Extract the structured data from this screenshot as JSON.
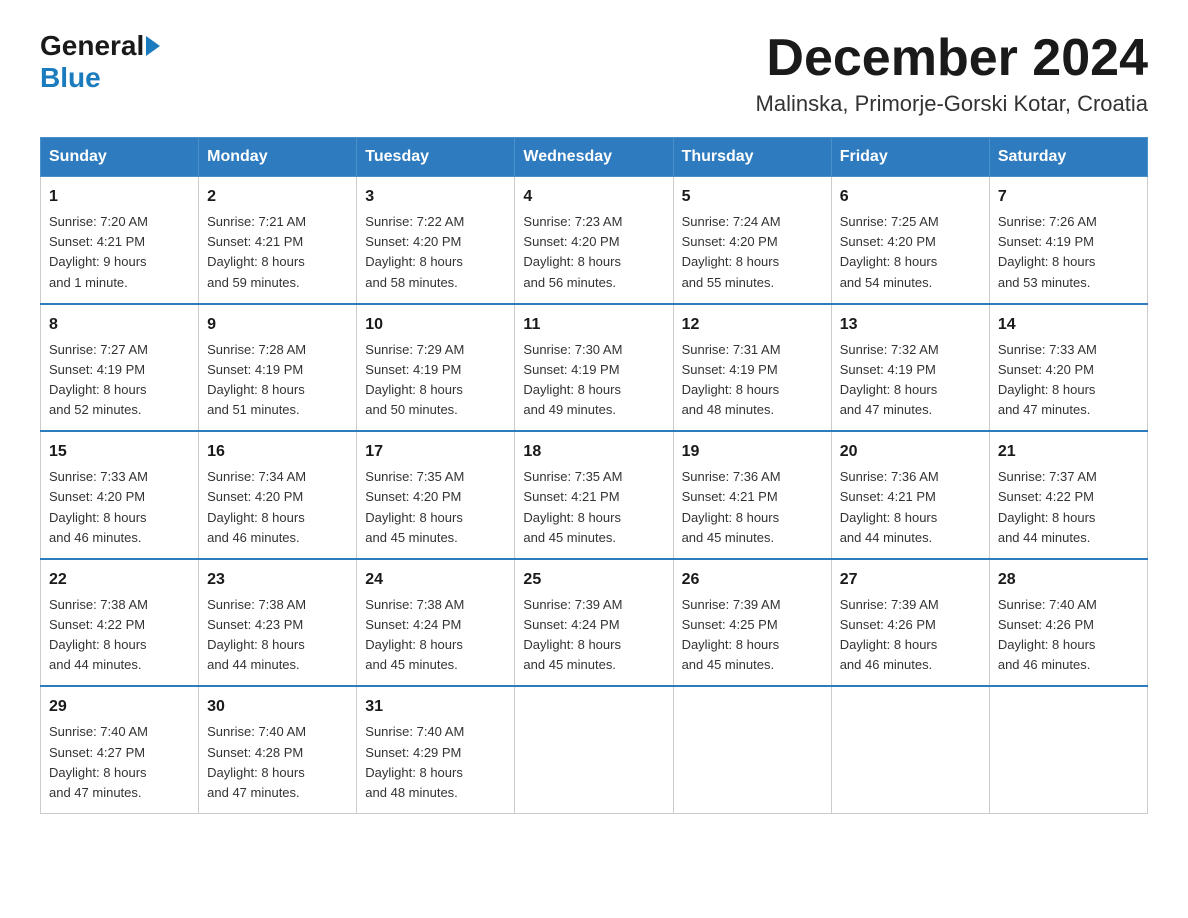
{
  "header": {
    "logo": {
      "general": "General",
      "blue": "Blue"
    },
    "month_year": "December 2024",
    "location": "Malinska, Primorje-Gorski Kotar, Croatia"
  },
  "weekdays": [
    "Sunday",
    "Monday",
    "Tuesday",
    "Wednesday",
    "Thursday",
    "Friday",
    "Saturday"
  ],
  "weeks": [
    [
      {
        "day": "1",
        "sunrise": "Sunrise: 7:20 AM",
        "sunset": "Sunset: 4:21 PM",
        "daylight": "Daylight: 9 hours",
        "daylight2": "and 1 minute."
      },
      {
        "day": "2",
        "sunrise": "Sunrise: 7:21 AM",
        "sunset": "Sunset: 4:21 PM",
        "daylight": "Daylight: 8 hours",
        "daylight2": "and 59 minutes."
      },
      {
        "day": "3",
        "sunrise": "Sunrise: 7:22 AM",
        "sunset": "Sunset: 4:20 PM",
        "daylight": "Daylight: 8 hours",
        "daylight2": "and 58 minutes."
      },
      {
        "day": "4",
        "sunrise": "Sunrise: 7:23 AM",
        "sunset": "Sunset: 4:20 PM",
        "daylight": "Daylight: 8 hours",
        "daylight2": "and 56 minutes."
      },
      {
        "day": "5",
        "sunrise": "Sunrise: 7:24 AM",
        "sunset": "Sunset: 4:20 PM",
        "daylight": "Daylight: 8 hours",
        "daylight2": "and 55 minutes."
      },
      {
        "day": "6",
        "sunrise": "Sunrise: 7:25 AM",
        "sunset": "Sunset: 4:20 PM",
        "daylight": "Daylight: 8 hours",
        "daylight2": "and 54 minutes."
      },
      {
        "day": "7",
        "sunrise": "Sunrise: 7:26 AM",
        "sunset": "Sunset: 4:19 PM",
        "daylight": "Daylight: 8 hours",
        "daylight2": "and 53 minutes."
      }
    ],
    [
      {
        "day": "8",
        "sunrise": "Sunrise: 7:27 AM",
        "sunset": "Sunset: 4:19 PM",
        "daylight": "Daylight: 8 hours",
        "daylight2": "and 52 minutes."
      },
      {
        "day": "9",
        "sunrise": "Sunrise: 7:28 AM",
        "sunset": "Sunset: 4:19 PM",
        "daylight": "Daylight: 8 hours",
        "daylight2": "and 51 minutes."
      },
      {
        "day": "10",
        "sunrise": "Sunrise: 7:29 AM",
        "sunset": "Sunset: 4:19 PM",
        "daylight": "Daylight: 8 hours",
        "daylight2": "and 50 minutes."
      },
      {
        "day": "11",
        "sunrise": "Sunrise: 7:30 AM",
        "sunset": "Sunset: 4:19 PM",
        "daylight": "Daylight: 8 hours",
        "daylight2": "and 49 minutes."
      },
      {
        "day": "12",
        "sunrise": "Sunrise: 7:31 AM",
        "sunset": "Sunset: 4:19 PM",
        "daylight": "Daylight: 8 hours",
        "daylight2": "and 48 minutes."
      },
      {
        "day": "13",
        "sunrise": "Sunrise: 7:32 AM",
        "sunset": "Sunset: 4:19 PM",
        "daylight": "Daylight: 8 hours",
        "daylight2": "and 47 minutes."
      },
      {
        "day": "14",
        "sunrise": "Sunrise: 7:33 AM",
        "sunset": "Sunset: 4:20 PM",
        "daylight": "Daylight: 8 hours",
        "daylight2": "and 47 minutes."
      }
    ],
    [
      {
        "day": "15",
        "sunrise": "Sunrise: 7:33 AM",
        "sunset": "Sunset: 4:20 PM",
        "daylight": "Daylight: 8 hours",
        "daylight2": "and 46 minutes."
      },
      {
        "day": "16",
        "sunrise": "Sunrise: 7:34 AM",
        "sunset": "Sunset: 4:20 PM",
        "daylight": "Daylight: 8 hours",
        "daylight2": "and 46 minutes."
      },
      {
        "day": "17",
        "sunrise": "Sunrise: 7:35 AM",
        "sunset": "Sunset: 4:20 PM",
        "daylight": "Daylight: 8 hours",
        "daylight2": "and 45 minutes."
      },
      {
        "day": "18",
        "sunrise": "Sunrise: 7:35 AM",
        "sunset": "Sunset: 4:21 PM",
        "daylight": "Daylight: 8 hours",
        "daylight2": "and 45 minutes."
      },
      {
        "day": "19",
        "sunrise": "Sunrise: 7:36 AM",
        "sunset": "Sunset: 4:21 PM",
        "daylight": "Daylight: 8 hours",
        "daylight2": "and 45 minutes."
      },
      {
        "day": "20",
        "sunrise": "Sunrise: 7:36 AM",
        "sunset": "Sunset: 4:21 PM",
        "daylight": "Daylight: 8 hours",
        "daylight2": "and 44 minutes."
      },
      {
        "day": "21",
        "sunrise": "Sunrise: 7:37 AM",
        "sunset": "Sunset: 4:22 PM",
        "daylight": "Daylight: 8 hours",
        "daylight2": "and 44 minutes."
      }
    ],
    [
      {
        "day": "22",
        "sunrise": "Sunrise: 7:38 AM",
        "sunset": "Sunset: 4:22 PM",
        "daylight": "Daylight: 8 hours",
        "daylight2": "and 44 minutes."
      },
      {
        "day": "23",
        "sunrise": "Sunrise: 7:38 AM",
        "sunset": "Sunset: 4:23 PM",
        "daylight": "Daylight: 8 hours",
        "daylight2": "and 44 minutes."
      },
      {
        "day": "24",
        "sunrise": "Sunrise: 7:38 AM",
        "sunset": "Sunset: 4:24 PM",
        "daylight": "Daylight: 8 hours",
        "daylight2": "and 45 minutes."
      },
      {
        "day": "25",
        "sunrise": "Sunrise: 7:39 AM",
        "sunset": "Sunset: 4:24 PM",
        "daylight": "Daylight: 8 hours",
        "daylight2": "and 45 minutes."
      },
      {
        "day": "26",
        "sunrise": "Sunrise: 7:39 AM",
        "sunset": "Sunset: 4:25 PM",
        "daylight": "Daylight: 8 hours",
        "daylight2": "and 45 minutes."
      },
      {
        "day": "27",
        "sunrise": "Sunrise: 7:39 AM",
        "sunset": "Sunset: 4:26 PM",
        "daylight": "Daylight: 8 hours",
        "daylight2": "and 46 minutes."
      },
      {
        "day": "28",
        "sunrise": "Sunrise: 7:40 AM",
        "sunset": "Sunset: 4:26 PM",
        "daylight": "Daylight: 8 hours",
        "daylight2": "and 46 minutes."
      }
    ],
    [
      {
        "day": "29",
        "sunrise": "Sunrise: 7:40 AM",
        "sunset": "Sunset: 4:27 PM",
        "daylight": "Daylight: 8 hours",
        "daylight2": "and 47 minutes."
      },
      {
        "day": "30",
        "sunrise": "Sunrise: 7:40 AM",
        "sunset": "Sunset: 4:28 PM",
        "daylight": "Daylight: 8 hours",
        "daylight2": "and 47 minutes."
      },
      {
        "day": "31",
        "sunrise": "Sunrise: 7:40 AM",
        "sunset": "Sunset: 4:29 PM",
        "daylight": "Daylight: 8 hours",
        "daylight2": "and 48 minutes."
      },
      null,
      null,
      null,
      null
    ]
  ]
}
